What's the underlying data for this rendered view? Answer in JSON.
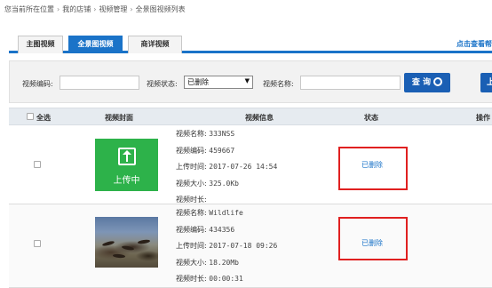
{
  "breadcrumb": [
    "您当前所在位置",
    "我的店铺",
    "视频管理",
    "全景图视频列表"
  ],
  "tabs": [
    {
      "label": "主图视频",
      "active": false
    },
    {
      "label": "全景图视频",
      "active": true
    },
    {
      "label": "商详视频",
      "active": false
    }
  ],
  "help_link": "点击查看帮",
  "filter": {
    "code_label": "视频编码:",
    "code_value": "",
    "status_label": "视频状态:",
    "status_selected": "已删除",
    "name_label": "视频名称:",
    "name_value": "",
    "query_button": "查 询",
    "upload_button": "上"
  },
  "table": {
    "select_all": "全选",
    "col_cover": "视频封面",
    "col_info": "视频信息",
    "col_status": "状态",
    "col_action": "操作",
    "rows": [
      {
        "cover_text": "上传中",
        "name_label": "视频名称:",
        "name": "333NSS",
        "code_label": "视频编码:",
        "code": "459667",
        "time_label": "上传时间:",
        "time": "2017-07-26 14:54",
        "size_label": "视频大小:",
        "size": "325.0Kb",
        "duration_label": "视频时长:",
        "duration": "",
        "status": "已删除"
      },
      {
        "cover_text": "",
        "name_label": "视频名称:",
        "name": "Wildlife",
        "code_label": "视频编码:",
        "code": "434356",
        "time_label": "上传时间:",
        "time": "2017-07-18 09:26",
        "size_label": "视频大小:",
        "size": "18.20Mb",
        "duration_label": "视频时长:",
        "duration": "00:00:31",
        "status": "已删除"
      }
    ]
  },
  "colors": {
    "accent": "#1a73c8",
    "upload_thumb": "#2db24a",
    "highlight_box": "#e02020"
  }
}
